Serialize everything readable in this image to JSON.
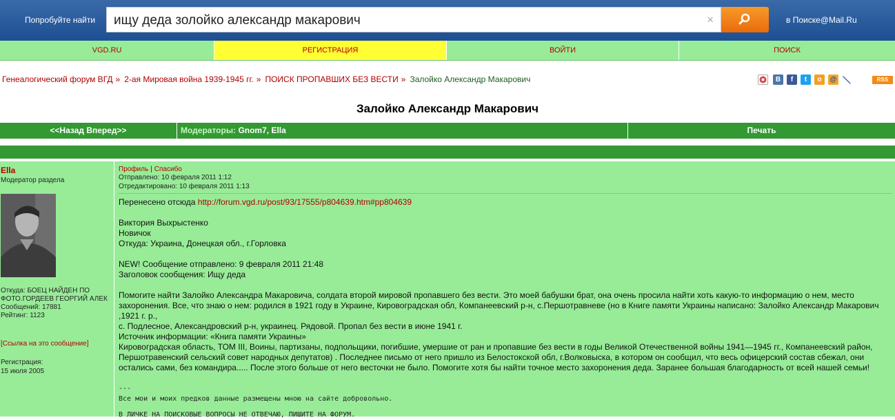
{
  "search": {
    "try_label": "Попробуйте найти",
    "query": "ищу деда золойко александр макарович",
    "clear_symbol": "×",
    "mail_link": "в Поиске@Mail.Ru"
  },
  "nav": {
    "items": [
      {
        "label": "VGD.RU"
      },
      {
        "label": "РЕГИСТРАЦИЯ"
      },
      {
        "label": "ВОЙТИ"
      },
      {
        "label": "ПОИСК"
      }
    ]
  },
  "breadcrumb": {
    "items": [
      {
        "label": "Генеалогический форум ВГД"
      },
      {
        "label": "2-ая Мировая война 1939-1945 гг."
      },
      {
        "label": "ПОИСК ПРОПАВШИХ БЕЗ ВЕСТИ"
      }
    ],
    "separator": "»",
    "current": "Залойко Александр Макарович"
  },
  "social": {
    "rss_label": "RSS",
    "icons": [
      "vk-icon",
      "facebook-icon",
      "twitter-icon",
      "odnoklassniki-icon",
      "mailru-icon",
      "livejournal-icon"
    ],
    "vk_glyph": "B",
    "fb_glyph": "f",
    "tw_glyph": "t",
    "ok_glyph": "о",
    "mail_glyph": "@"
  },
  "page_title": "Залойко Александр Макарович",
  "toolbar": {
    "back_forward": "<<Назад  Вперед>>",
    "moderators_label": "Модераторы:",
    "moderators": "Gnom7, Ella",
    "print": "Печать"
  },
  "post": {
    "author": {
      "name": "Ella",
      "rank": "Модератор раздела",
      "from": "Откуда: БОЕЦ НАЙДЕН ПО",
      "from2": "ФОТО.ГОРДЕЕВ ГЕОРГИЙ АЛЕК",
      "messages": "Сообщений: 17881",
      "rating": "Рейтинг: 1123",
      "link": "[Ссылка на это сообщение]",
      "reg_label": "Регистрация:",
      "reg_date": "15 июля 2005"
    },
    "actions": {
      "profile": "Профиль",
      "sep": "|",
      "thanks": "Спасибо"
    },
    "sent": "Отправлено: 10 февраля 2011 1:12",
    "edited": "Отредактировано: 10 февраля 2011 1:13",
    "moved_label": "Перенесено отсюда",
    "moved_url": "http://forum.vgd.ru/post/93/17555/p804639.htm#pp804639",
    "lines1": [
      "Виктория Выхрыстенко",
      "Новичок",
      "Откуда: Украина, Донецкая обл., г.Горловка"
    ],
    "lines2": [
      "NEW! Сообщение отправлено: 9 февраля 2011 21:48",
      "Заголовок сообщения: Ищу деда"
    ],
    "paragraph": [
      "Помогите найти Залойко Александра Макаровича, солдата второй мировой пропавшего без вести. Это моей бабушки брат, она очень просила найти хоть какую-то информацию о нем, место",
      "захоронения. Все, что знаю о нем: родился в 1921 году в Украине, Кировоградская обл, Компанеевский р-н, с.Першотравневе (но в Книге памяти Украины написано: Залойко Александр Макарович",
      ",1921 г. р.,",
      "с. Подлесное, Александровский р-н, украинец. Рядовой. Пропал без вести в июне 1941 г.",
      "Источник информации: «Книга памяти Украины»",
      "Кировоградская область, ТОМ III, Воины, партизаны, подпольщики, погибшие, умершие от ран и пропавшие без вести в годы Великой Отечественной войны 1941—1945 гг., Компанеевский район,",
      "Першотравенский сельский совет народных депутатов) . Последнее письмо от него пришло из Белостокской обл, г.Волковыска, в котором он сообщил, что весь офицерский состав сбежал, они",
      "остались сами, без командира..... После этого больше от него весточки не было. Помогите хотя бы найти точное место захоронения деда. Заранее большая благодарность от всей нашей семьи!"
    ],
    "sig_dash": "---",
    "sig1": "Все мои и моих предков данные размещены мною на сайте добровольно.",
    "sig2": "В ЛИЧКЕ НА ПОИСКОВЫЕ ВОПРОСЫ НЕ ОТВЕЧАЮ, ПИШИТЕ НА ФОРУМ."
  }
}
